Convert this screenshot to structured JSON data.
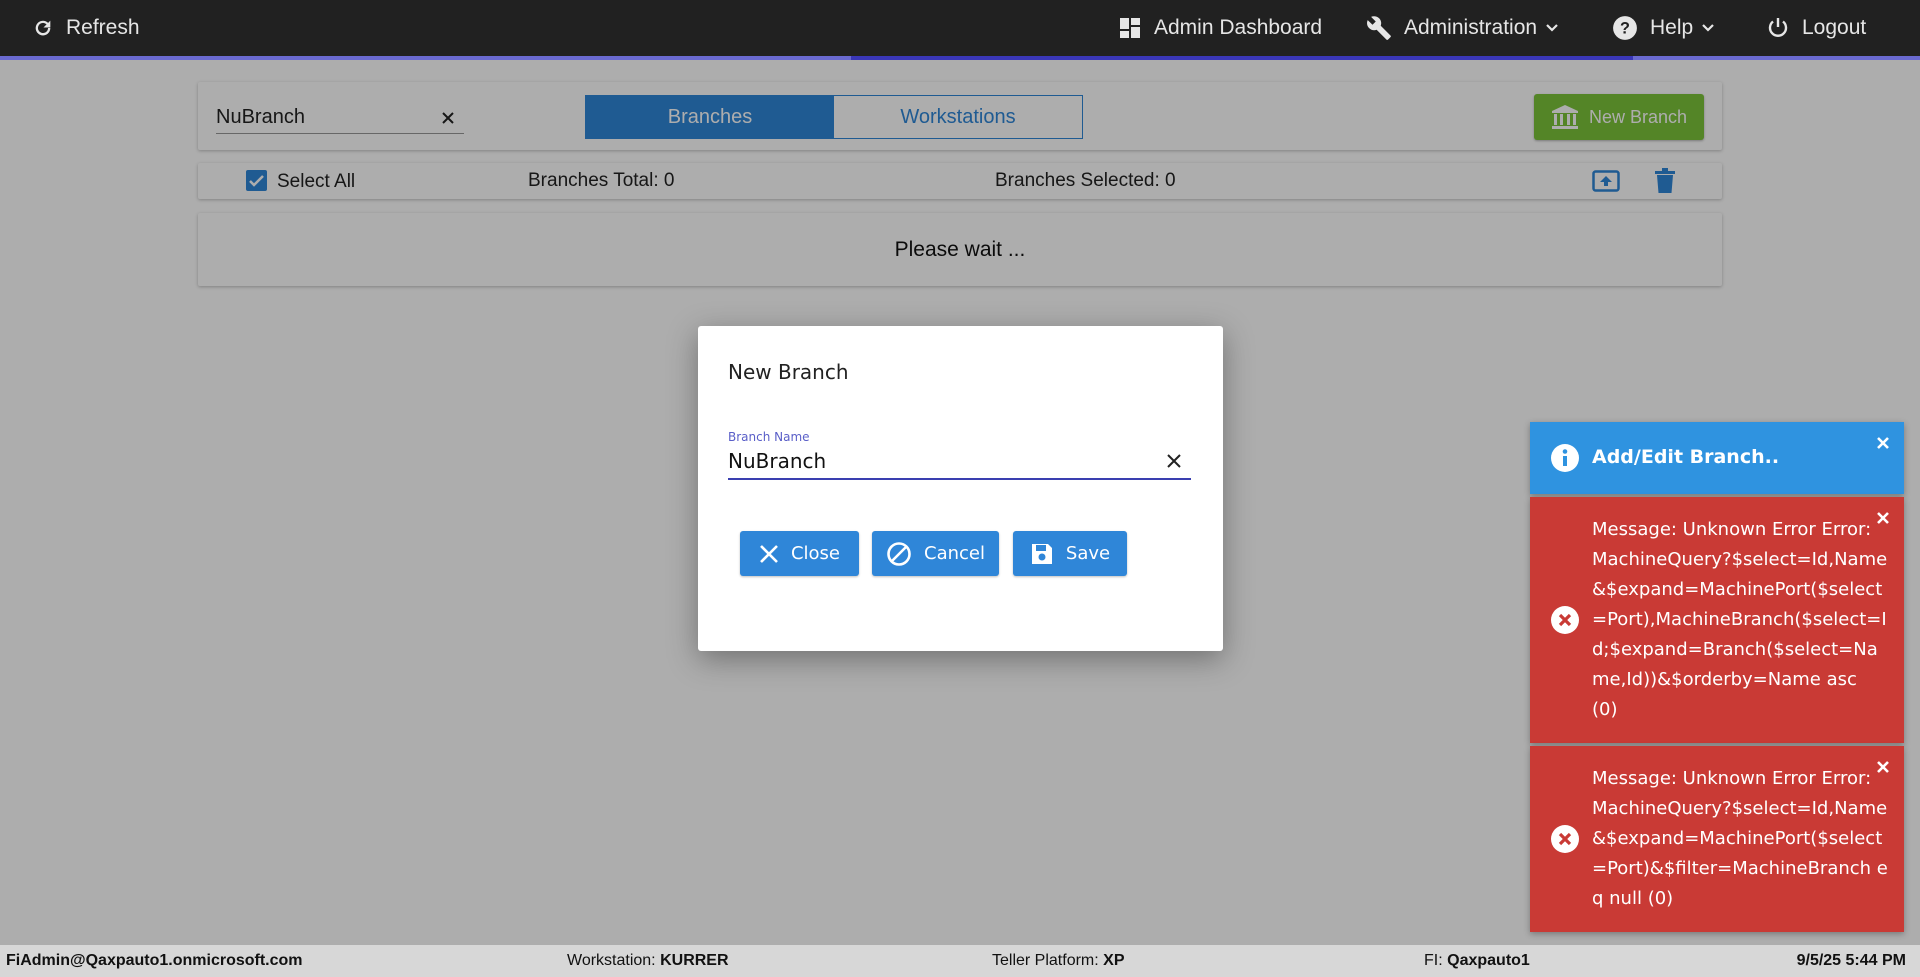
{
  "topbar": {
    "refresh_label": "Refresh",
    "admin_dashboard_label": "Admin Dashboard",
    "administration_label": "Administration",
    "help_label": "Help",
    "logout_label": "Logout"
  },
  "toolbar": {
    "search_value": "NuBranch",
    "tabs": [
      {
        "label": "Branches",
        "active": true
      },
      {
        "label": "Workstations",
        "active": false
      }
    ],
    "new_branch_label": "New Branch"
  },
  "selection": {
    "select_all_label": "Select All",
    "select_all_checked": true,
    "branches_total": "Branches Total: 0",
    "branches_selected": "Branches Selected: 0"
  },
  "content": {
    "wait_text": "Please wait ..."
  },
  "modal": {
    "title": "New Branch",
    "field_label": "Branch Name",
    "field_value": "NuBranch",
    "close_label": "Close",
    "cancel_label": "Cancel",
    "save_label": "Save"
  },
  "toasts": [
    {
      "type": "info",
      "title": "Add/Edit Branch.."
    },
    {
      "type": "error",
      "message": "Message: Unknown Error Error: MachineQuery?$select=Id,Name&$expand=MachinePort($select=Port),MachineBranch($select=Id;$expand=Branch($select=Name,Id))&$orderby=Name asc (0)"
    },
    {
      "type": "error",
      "message": "Message: Unknown Error Error: MachineQuery?$select=Id,Name&$expand=MachinePort($select=Port)&$filter=MachineBranch eq null (0)"
    }
  ],
  "footer": {
    "user": "FiAdmin@Qaxpauto1.onmicrosoft.com",
    "workstation_label": "Workstation:",
    "workstation_value": "KURRER",
    "platform_label": "Teller Platform:",
    "platform_value": "XP",
    "fi_label": "FI:",
    "fi_value": "Qaxpauto1",
    "datetime": "9/5/25 5:44 PM"
  },
  "colors": {
    "topbar": "#212121",
    "primary": "#2f86d8",
    "success": "#7cc53a",
    "error": "#c93a35",
    "info": "#2f93e0"
  }
}
